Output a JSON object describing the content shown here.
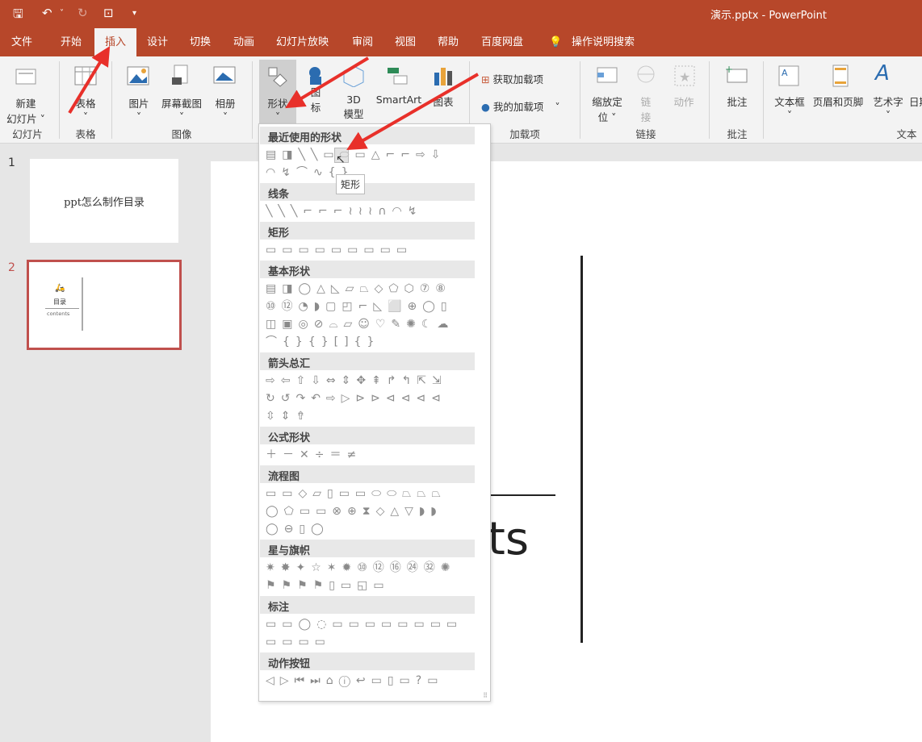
{
  "window": {
    "title": "演示.pptx  -  PowerPoint"
  },
  "quick_access": [
    "🖫",
    "↶",
    "˅",
    "↻",
    "⊡",
    "▾"
  ],
  "tabs": [
    "文件",
    "开始",
    "插入",
    "设计",
    "切换",
    "动画",
    "幻灯片放映",
    "审阅",
    "视图",
    "帮助",
    "百度网盘",
    "操作说明搜索"
  ],
  "active_tab": "插入",
  "ribbon": {
    "new_slide": "新建",
    "new_slide2": "幻灯片 ˅",
    "group_slides": "幻灯片",
    "table": "表格",
    "group_table": "表格",
    "picture": "图片",
    "screenshot": "屏幕截图",
    "album": "相册",
    "group_images": "图像",
    "shapes": "形状",
    "icons1": "图",
    "icons2": "标",
    "model1": "3D",
    "model2": "模型",
    "smartart": "SmartArt",
    "chart": "图表",
    "get_addins": "获取加载项",
    "my_addins": "我的加载项",
    "group_addins": "加载项",
    "zoom1": "缩放定",
    "zoom2": "位 ˅",
    "link1": "链",
    "link2": "接",
    "action": "动作",
    "group_links": "链接",
    "comment": "批注",
    "group_comments": "批注",
    "textbox": "文本框",
    "header_footer": "页眉和页脚",
    "wordart": "艺术字",
    "date": "日期",
    "group_text": "文本"
  },
  "slides": [
    {
      "num": "1",
      "title": "ppt怎么制作目录"
    },
    {
      "num": "2",
      "title": "目录",
      "subtitle": "contents"
    }
  ],
  "slide_content": {
    "subtitle": "contents"
  },
  "shapes_gallery": {
    "sections": [
      {
        "title": "最近使用的形状",
        "rows": [
          "▤◨╲╲▭⬭▭△⌐⌐⇨⇩",
          "◠↯⌒∿{}"
        ]
      },
      {
        "title": "线条",
        "rows": [
          "╲╲╲⌐⌐⌐≀≀≀∩◠↯"
        ]
      },
      {
        "title": "矩形",
        "rows": [
          "▭▭▭▭▭▭▭▭▭"
        ]
      },
      {
        "title": "基本形状",
        "rows": [
          "▤◨◯△◺▱⏢◇⬠⬡⑦⑧",
          "⑩⑫◔◗▢◰⌐◺⬜⊕◯▯",
          "◫▣◎⊘⌓▱☺♡✎✺☾☁",
          "⌒{}{}[]{}"
        ]
      },
      {
        "title": "箭头总汇",
        "rows": [
          "⇨⇦⇧⇩⇔⇕✥⇞↱↰⇱⇲",
          "↻↺↷↶⇨▷⊳⊳⊲⊲⊲⊲",
          "⇳⇕⇮"
        ]
      },
      {
        "title": "公式形状",
        "rows": [
          "＋－✕÷＝≠"
        ]
      },
      {
        "title": "流程图",
        "rows": [
          "▭▭◇▱▯▭▭⬭⬭⏢⏢⏢",
          "◯⬠▭▭⊗⊕⧗◇△▽◗◗",
          "◯⊖▯◯"
        ]
      },
      {
        "title": "星与旗帜",
        "rows": [
          "✷✸✦☆✶✹⑩⑫⑯㉔㉜✺",
          "⚑⚑⚑⚑▯▭◱▭"
        ]
      },
      {
        "title": "标注",
        "rows": [
          "▭▭◯◌▭▭▭▭▭▭▭▭",
          "▭▭▭▭"
        ]
      },
      {
        "title": "动作按钮",
        "rows": [
          "◁▷⏮⏭⌂ⓘ↩▭▯▭?▭"
        ]
      }
    ],
    "tooltip": "矩形",
    "hovered": "矩形"
  },
  "colors": {
    "accent": "#b7472a",
    "annotation_arrow": "#e8302a"
  }
}
